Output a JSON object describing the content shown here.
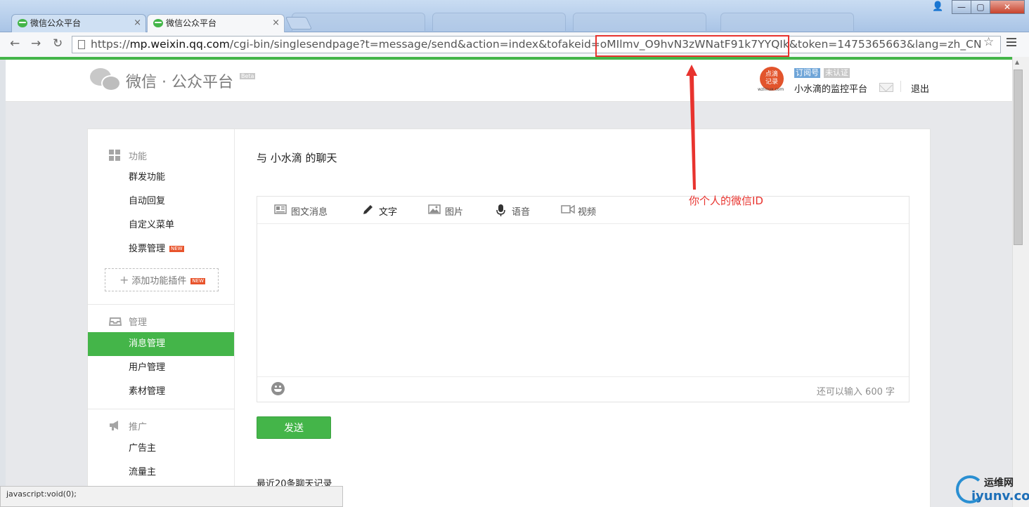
{
  "browser": {
    "tabs": [
      {
        "title": "微信公众平台",
        "close": "×"
      },
      {
        "title": "微信公众平台",
        "close": "×"
      }
    ],
    "url_prefix": "https://",
    "url_host": "mp.weixin.qq.com",
    "url_path": "/cgi-bin/singlesendpage?t=message/send&action=index&tofakeid=oMIlmv_O9hvN3zWNatF91k7YYQIk&token=1475365663&lang=zh_CN",
    "status_text": "javascript:void(0);"
  },
  "header": {
    "logo_text": "微信 · 公众平台",
    "beta": "Beta",
    "account_avatar_text": "点滴\n记录",
    "account_domain": "wzlinux.com",
    "badge_subscription": "订阅号",
    "badge_unverified": "未认证",
    "account_name": "小水滴的监控平台",
    "logout": "退出"
  },
  "sidebar": {
    "sections": [
      {
        "title": "功能",
        "items": [
          "群发功能",
          "自动回复",
          "自定义菜单",
          "投票管理"
        ]
      },
      {
        "title": "管理",
        "items": [
          "消息管理",
          "用户管理",
          "素材管理"
        ]
      },
      {
        "title": "推广",
        "items": [
          "广告主",
          "流量主"
        ]
      }
    ],
    "new_tag": "NEW",
    "add_plugin": "添加功能插件",
    "active_item": "消息管理"
  },
  "main": {
    "chat_title": "与 小水滴 的聊天",
    "editor_tabs": [
      "图文消息",
      "文字",
      "图片",
      "语音",
      "视频"
    ],
    "active_tab": "文字",
    "counter": "还可以输入 600 字",
    "send_label": "发送",
    "history_title": "最近20条聊天记录"
  },
  "annotation": {
    "label": "你个人的微信ID",
    "color": "#e8332e"
  },
  "watermark": {
    "cn": "运维网",
    "en": "iyunv.com"
  },
  "colors": {
    "brand_green": "#44b549",
    "annotation_red": "#e8332e"
  }
}
